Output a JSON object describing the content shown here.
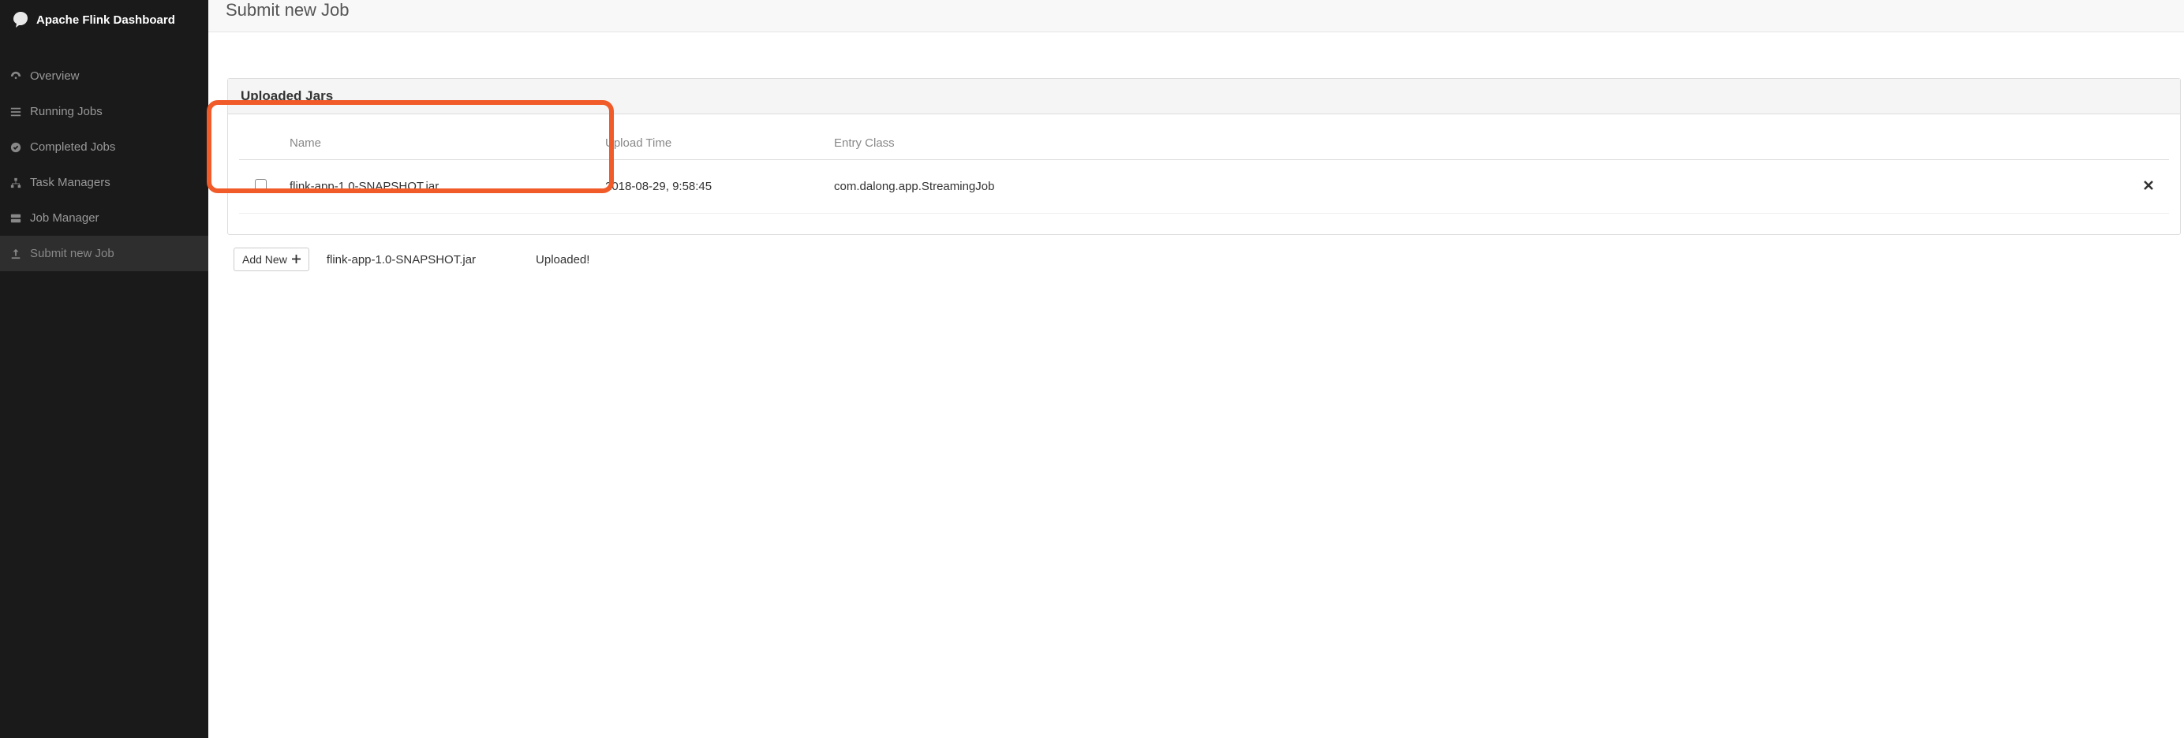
{
  "app": {
    "title": "Apache Flink Dashboard"
  },
  "sidebar": {
    "items": [
      {
        "label": "Overview"
      },
      {
        "label": "Running Jobs"
      },
      {
        "label": "Completed Jobs"
      },
      {
        "label": "Task Managers"
      },
      {
        "label": "Job Manager"
      },
      {
        "label": "Submit new Job"
      }
    ]
  },
  "page": {
    "title": "Submit new Job"
  },
  "panel": {
    "title": "Uploaded Jars",
    "columns": {
      "name": "Name",
      "upload_time": "Upload Time",
      "entry_class": "Entry Class"
    },
    "rows": [
      {
        "name": "flink-app-1.0-SNAPSHOT.jar",
        "upload_time": "2018-08-29, 9:58:45",
        "entry_class": "com.dalong.app.StreamingJob"
      }
    ]
  },
  "footer": {
    "add_new_label": "Add New",
    "filename": "flink-app-1.0-SNAPSHOT.jar",
    "status": "Uploaded!"
  }
}
